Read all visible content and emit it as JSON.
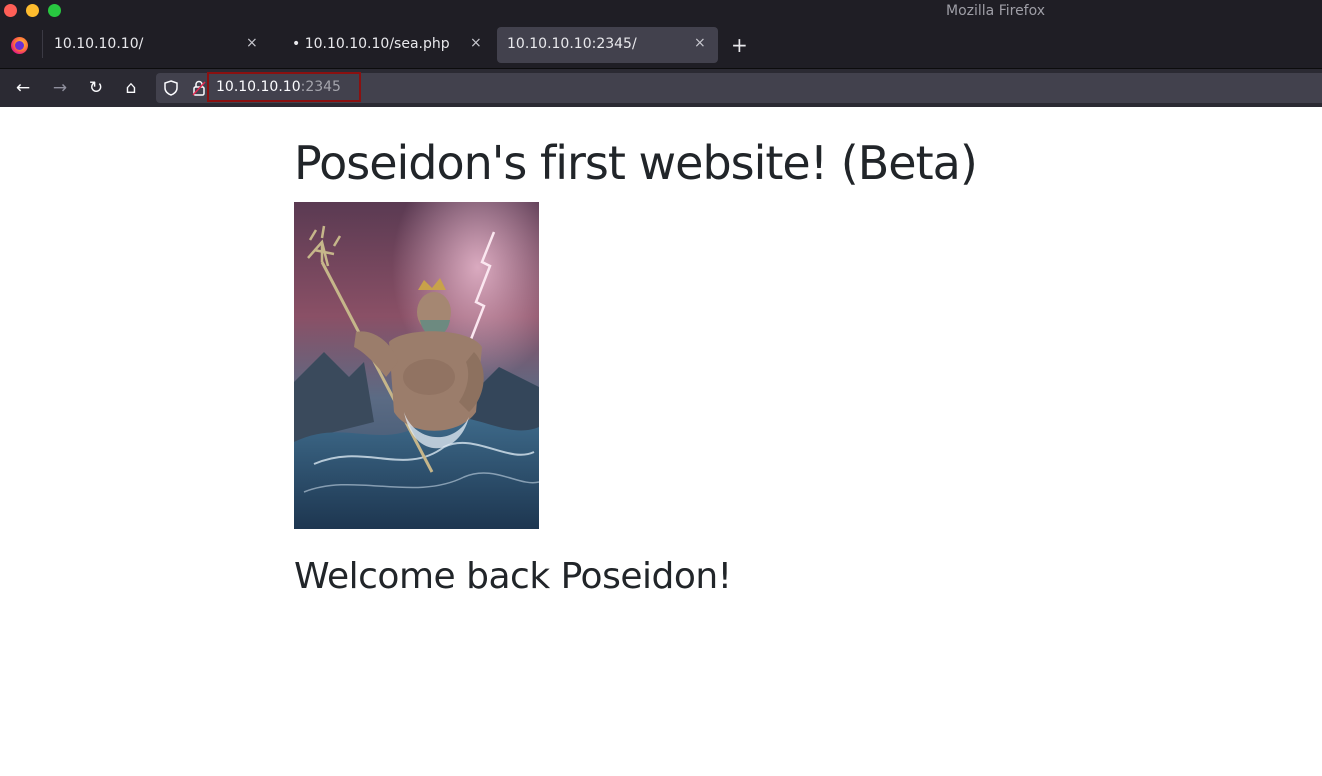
{
  "window": {
    "title": "Mozilla Firefox"
  },
  "tabs": [
    {
      "label": "10.10.10.10/",
      "close": "×",
      "active": false
    },
    {
      "label": "• 10.10.10.10/sea.php",
      "close": "×",
      "active": false
    },
    {
      "label": "10.10.10.10:2345/",
      "close": "×",
      "active": true
    }
  ],
  "tabstrip": {
    "new_tab": "+"
  },
  "navbar": {
    "back": "←",
    "forward": "→",
    "reload": "↻",
    "home": "⌂",
    "url_host": "10.10.10.10",
    "url_port": ":2345"
  },
  "page": {
    "heading": "Poseidon's first website! (Beta)",
    "welcome": "Welcome back Poseidon!"
  },
  "icons": {
    "shield": "shield-icon",
    "lock": "lock-icon",
    "firefox": "firefox-logo-icon"
  },
  "colors": {
    "chrome_dark": "#1f1e25",
    "navbar": "#2b2a33",
    "active_tab": "#42414d",
    "url_highlight": "#8b1010",
    "text": "#212529"
  }
}
